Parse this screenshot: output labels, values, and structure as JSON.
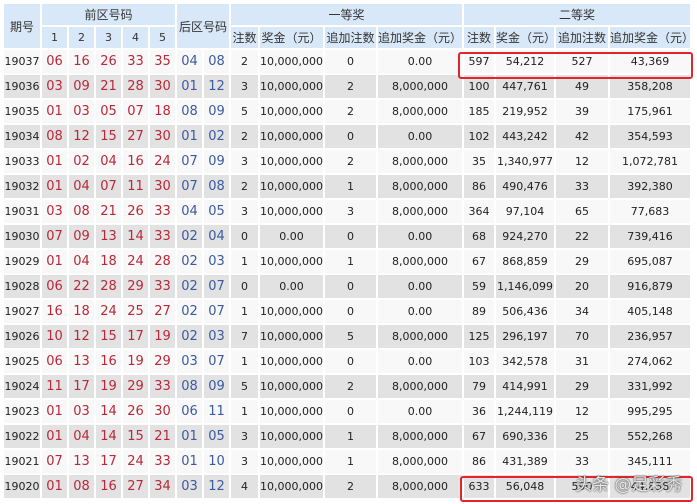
{
  "header": {
    "issue": "期号",
    "front": "前区号码",
    "front_cols": [
      "1",
      "2",
      "3",
      "4",
      "5"
    ],
    "back": "后区号码",
    "first_prize": "一等奖",
    "second_prize": "二等奖",
    "sub_cols": [
      "注数",
      "奖金（元）",
      "追加注数",
      "追加奖金（元）"
    ]
  },
  "rows": [
    {
      "issue": "19037",
      "front": [
        "06",
        "16",
        "26",
        "33",
        "35"
      ],
      "back": [
        "04",
        "08"
      ],
      "p1": [
        "2",
        "10,000,000",
        "0",
        "0.00"
      ],
      "p2": [
        "597",
        "54,212",
        "527",
        "43,369"
      ]
    },
    {
      "issue": "19036",
      "front": [
        "03",
        "09",
        "21",
        "28",
        "30"
      ],
      "back": [
        "01",
        "12"
      ],
      "p1": [
        "3",
        "10,000,000",
        "2",
        "8,000,000"
      ],
      "p2": [
        "100",
        "447,761",
        "49",
        "358,208"
      ]
    },
    {
      "issue": "19035",
      "front": [
        "01",
        "03",
        "05",
        "07",
        "18"
      ],
      "back": [
        "08",
        "09"
      ],
      "p1": [
        "5",
        "10,000,000",
        "2",
        "8,000,000"
      ],
      "p2": [
        "185",
        "219,952",
        "39",
        "175,961"
      ]
    },
    {
      "issue": "19034",
      "front": [
        "08",
        "12",
        "15",
        "27",
        "30"
      ],
      "back": [
        "01",
        "02"
      ],
      "p1": [
        "2",
        "10,000,000",
        "0",
        "0.00"
      ],
      "p2": [
        "102",
        "443,242",
        "42",
        "354,593"
      ]
    },
    {
      "issue": "19033",
      "front": [
        "01",
        "02",
        "04",
        "16",
        "24"
      ],
      "back": [
        "07",
        "09"
      ],
      "p1": [
        "3",
        "10,000,000",
        "2",
        "8,000,000"
      ],
      "p2": [
        "35",
        "1,340,977",
        "12",
        "1,072,781"
      ]
    },
    {
      "issue": "19032",
      "front": [
        "01",
        "04",
        "07",
        "11",
        "30"
      ],
      "back": [
        "07",
        "08"
      ],
      "p1": [
        "2",
        "10,000,000",
        "1",
        "8,000,000"
      ],
      "p2": [
        "86",
        "490,476",
        "33",
        "392,380"
      ]
    },
    {
      "issue": "19031",
      "front": [
        "03",
        "08",
        "21",
        "26",
        "33"
      ],
      "back": [
        "04",
        "05"
      ],
      "p1": [
        "3",
        "10,000,000",
        "3",
        "8,000,000"
      ],
      "p2": [
        "364",
        "97,104",
        "65",
        "77,683"
      ]
    },
    {
      "issue": "19030",
      "front": [
        "07",
        "09",
        "13",
        "14",
        "33"
      ],
      "back": [
        "02",
        "04"
      ],
      "p1": [
        "0",
        "0.00",
        "0",
        "0.00"
      ],
      "p2": [
        "68",
        "924,270",
        "22",
        "739,416"
      ]
    },
    {
      "issue": "19029",
      "front": [
        "01",
        "04",
        "18",
        "24",
        "28"
      ],
      "back": [
        "02",
        "03"
      ],
      "p1": [
        "1",
        "10,000,000",
        "1",
        "8,000,000"
      ],
      "p2": [
        "67",
        "868,859",
        "29",
        "695,087"
      ]
    },
    {
      "issue": "19028",
      "front": [
        "06",
        "22",
        "28",
        "29",
        "33"
      ],
      "back": [
        "02",
        "07"
      ],
      "p1": [
        "0",
        "0.00",
        "0",
        "0.00"
      ],
      "p2": [
        "59",
        "1,146,099",
        "20",
        "916,879"
      ]
    },
    {
      "issue": "19027",
      "front": [
        "16",
        "18",
        "24",
        "25",
        "27"
      ],
      "back": [
        "02",
        "07"
      ],
      "p1": [
        "1",
        "10,000,000",
        "0",
        "0.00"
      ],
      "p2": [
        "89",
        "506,436",
        "34",
        "405,148"
      ]
    },
    {
      "issue": "19026",
      "front": [
        "10",
        "12",
        "15",
        "17",
        "19"
      ],
      "back": [
        "02",
        "03"
      ],
      "p1": [
        "7",
        "10,000,000",
        "5",
        "8,000,000"
      ],
      "p2": [
        "125",
        "296,197",
        "70",
        "236,957"
      ]
    },
    {
      "issue": "19025",
      "front": [
        "06",
        "13",
        "16",
        "19",
        "29"
      ],
      "back": [
        "03",
        "07"
      ],
      "p1": [
        "1",
        "10,000,000",
        "0",
        "0.00"
      ],
      "p2": [
        "103",
        "342,578",
        "31",
        "274,062"
      ]
    },
    {
      "issue": "19024",
      "front": [
        "11",
        "17",
        "19",
        "29",
        "33"
      ],
      "back": [
        "08",
        "09"
      ],
      "p1": [
        "5",
        "10,000,000",
        "2",
        "8,000,000"
      ],
      "p2": [
        "79",
        "414,991",
        "29",
        "331,992"
      ]
    },
    {
      "issue": "19023",
      "front": [
        "01",
        "03",
        "14",
        "26",
        "30"
      ],
      "back": [
        "06",
        "11"
      ],
      "p1": [
        "1",
        "10,000,000",
        "0",
        "0.00"
      ],
      "p2": [
        "36",
        "1,244,119",
        "12",
        "995,295"
      ]
    },
    {
      "issue": "19022",
      "front": [
        "01",
        "04",
        "14",
        "15",
        "21"
      ],
      "back": [
        "01",
        "05"
      ],
      "p1": [
        "3",
        "10,000,000",
        "1",
        "8,000,000"
      ],
      "p2": [
        "67",
        "690,336",
        "25",
        "552,268"
      ]
    },
    {
      "issue": "19021",
      "front": [
        "07",
        "13",
        "17",
        "24",
        "33"
      ],
      "back": [
        "01",
        "10"
      ],
      "p1": [
        "3",
        "10,000,000",
        "1",
        "8,000,000"
      ],
      "p2": [
        "86",
        "431,389",
        "33",
        "345,111"
      ]
    },
    {
      "issue": "19020",
      "front": [
        "01",
        "08",
        "16",
        "27",
        "34"
      ],
      "back": [
        "03",
        "12"
      ],
      "p1": [
        "4",
        "10,000,000",
        "2",
        "8,000,000"
      ],
      "p2": [
        "633",
        "56,048",
        "590",
        "44,838"
      ]
    }
  ],
  "watermark": "头条 @足彩秀",
  "colors": {
    "front": "#b8283a",
    "back": "#3b5aa0",
    "highlight": "#e0262a",
    "header_bg": "#d9e8f8"
  }
}
